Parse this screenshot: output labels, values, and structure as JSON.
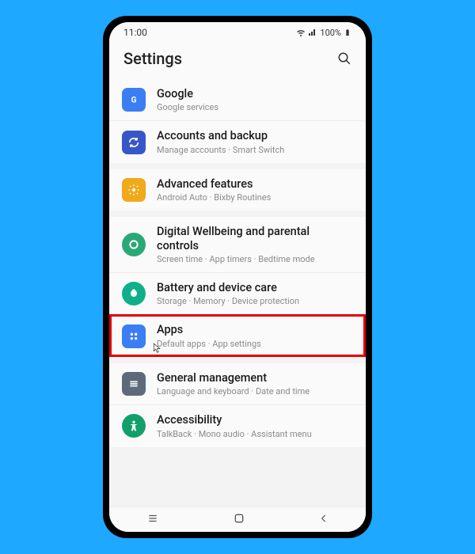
{
  "status": {
    "time": "11:00",
    "battery": "100%"
  },
  "header": {
    "title": "Settings"
  },
  "items": [
    {
      "title": "Google",
      "sub": "Google services",
      "color": "#3b7ef4"
    },
    {
      "title": "Accounts and backup",
      "sub": "Manage accounts · Smart Switch",
      "color": "#3757c9"
    },
    {
      "title": "Advanced features",
      "sub": "Android Auto · Bixby Routines",
      "color": "#f0a91b"
    },
    {
      "title": "Digital Wellbeing and parental controls",
      "sub": "Screen time · App timers · Bedtime mode",
      "color": "#2aa876"
    },
    {
      "title": "Battery and device care",
      "sub": "Storage · Memory · Device protection",
      "color": "#0fb089"
    },
    {
      "title": "Apps",
      "sub": "Default apps · App settings",
      "color": "#3b7ef4"
    },
    {
      "title": "General management",
      "sub": "Language and keyboard · Date and time",
      "color": "#5e6a7a"
    },
    {
      "title": "Accessibility",
      "sub": "TalkBack · Mono audio · Assistant menu",
      "color": "#12a06a"
    }
  ]
}
